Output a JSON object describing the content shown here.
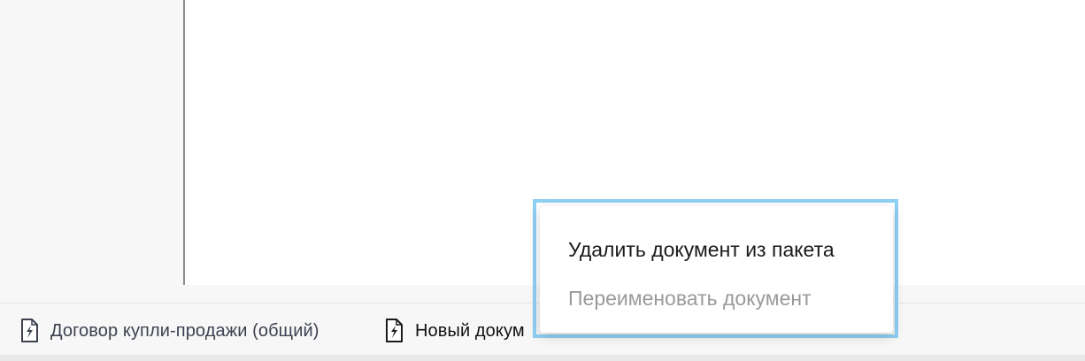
{
  "context_menu": {
    "items": [
      {
        "label": "Удалить документ из пакета",
        "enabled": true
      },
      {
        "label": "Переименовать документ",
        "enabled": false
      }
    ]
  },
  "document_tabs": [
    {
      "label": "Договор купли-продажи (общий)",
      "icon": "document-lightning-icon"
    },
    {
      "label": "Новый докум",
      "icon": "document-lightning-icon",
      "active": true
    }
  ],
  "colors": {
    "highlight_border": "#8fd0f5",
    "panel_background": "#f7f7f7",
    "disabled_text": "#9a9a9a"
  }
}
